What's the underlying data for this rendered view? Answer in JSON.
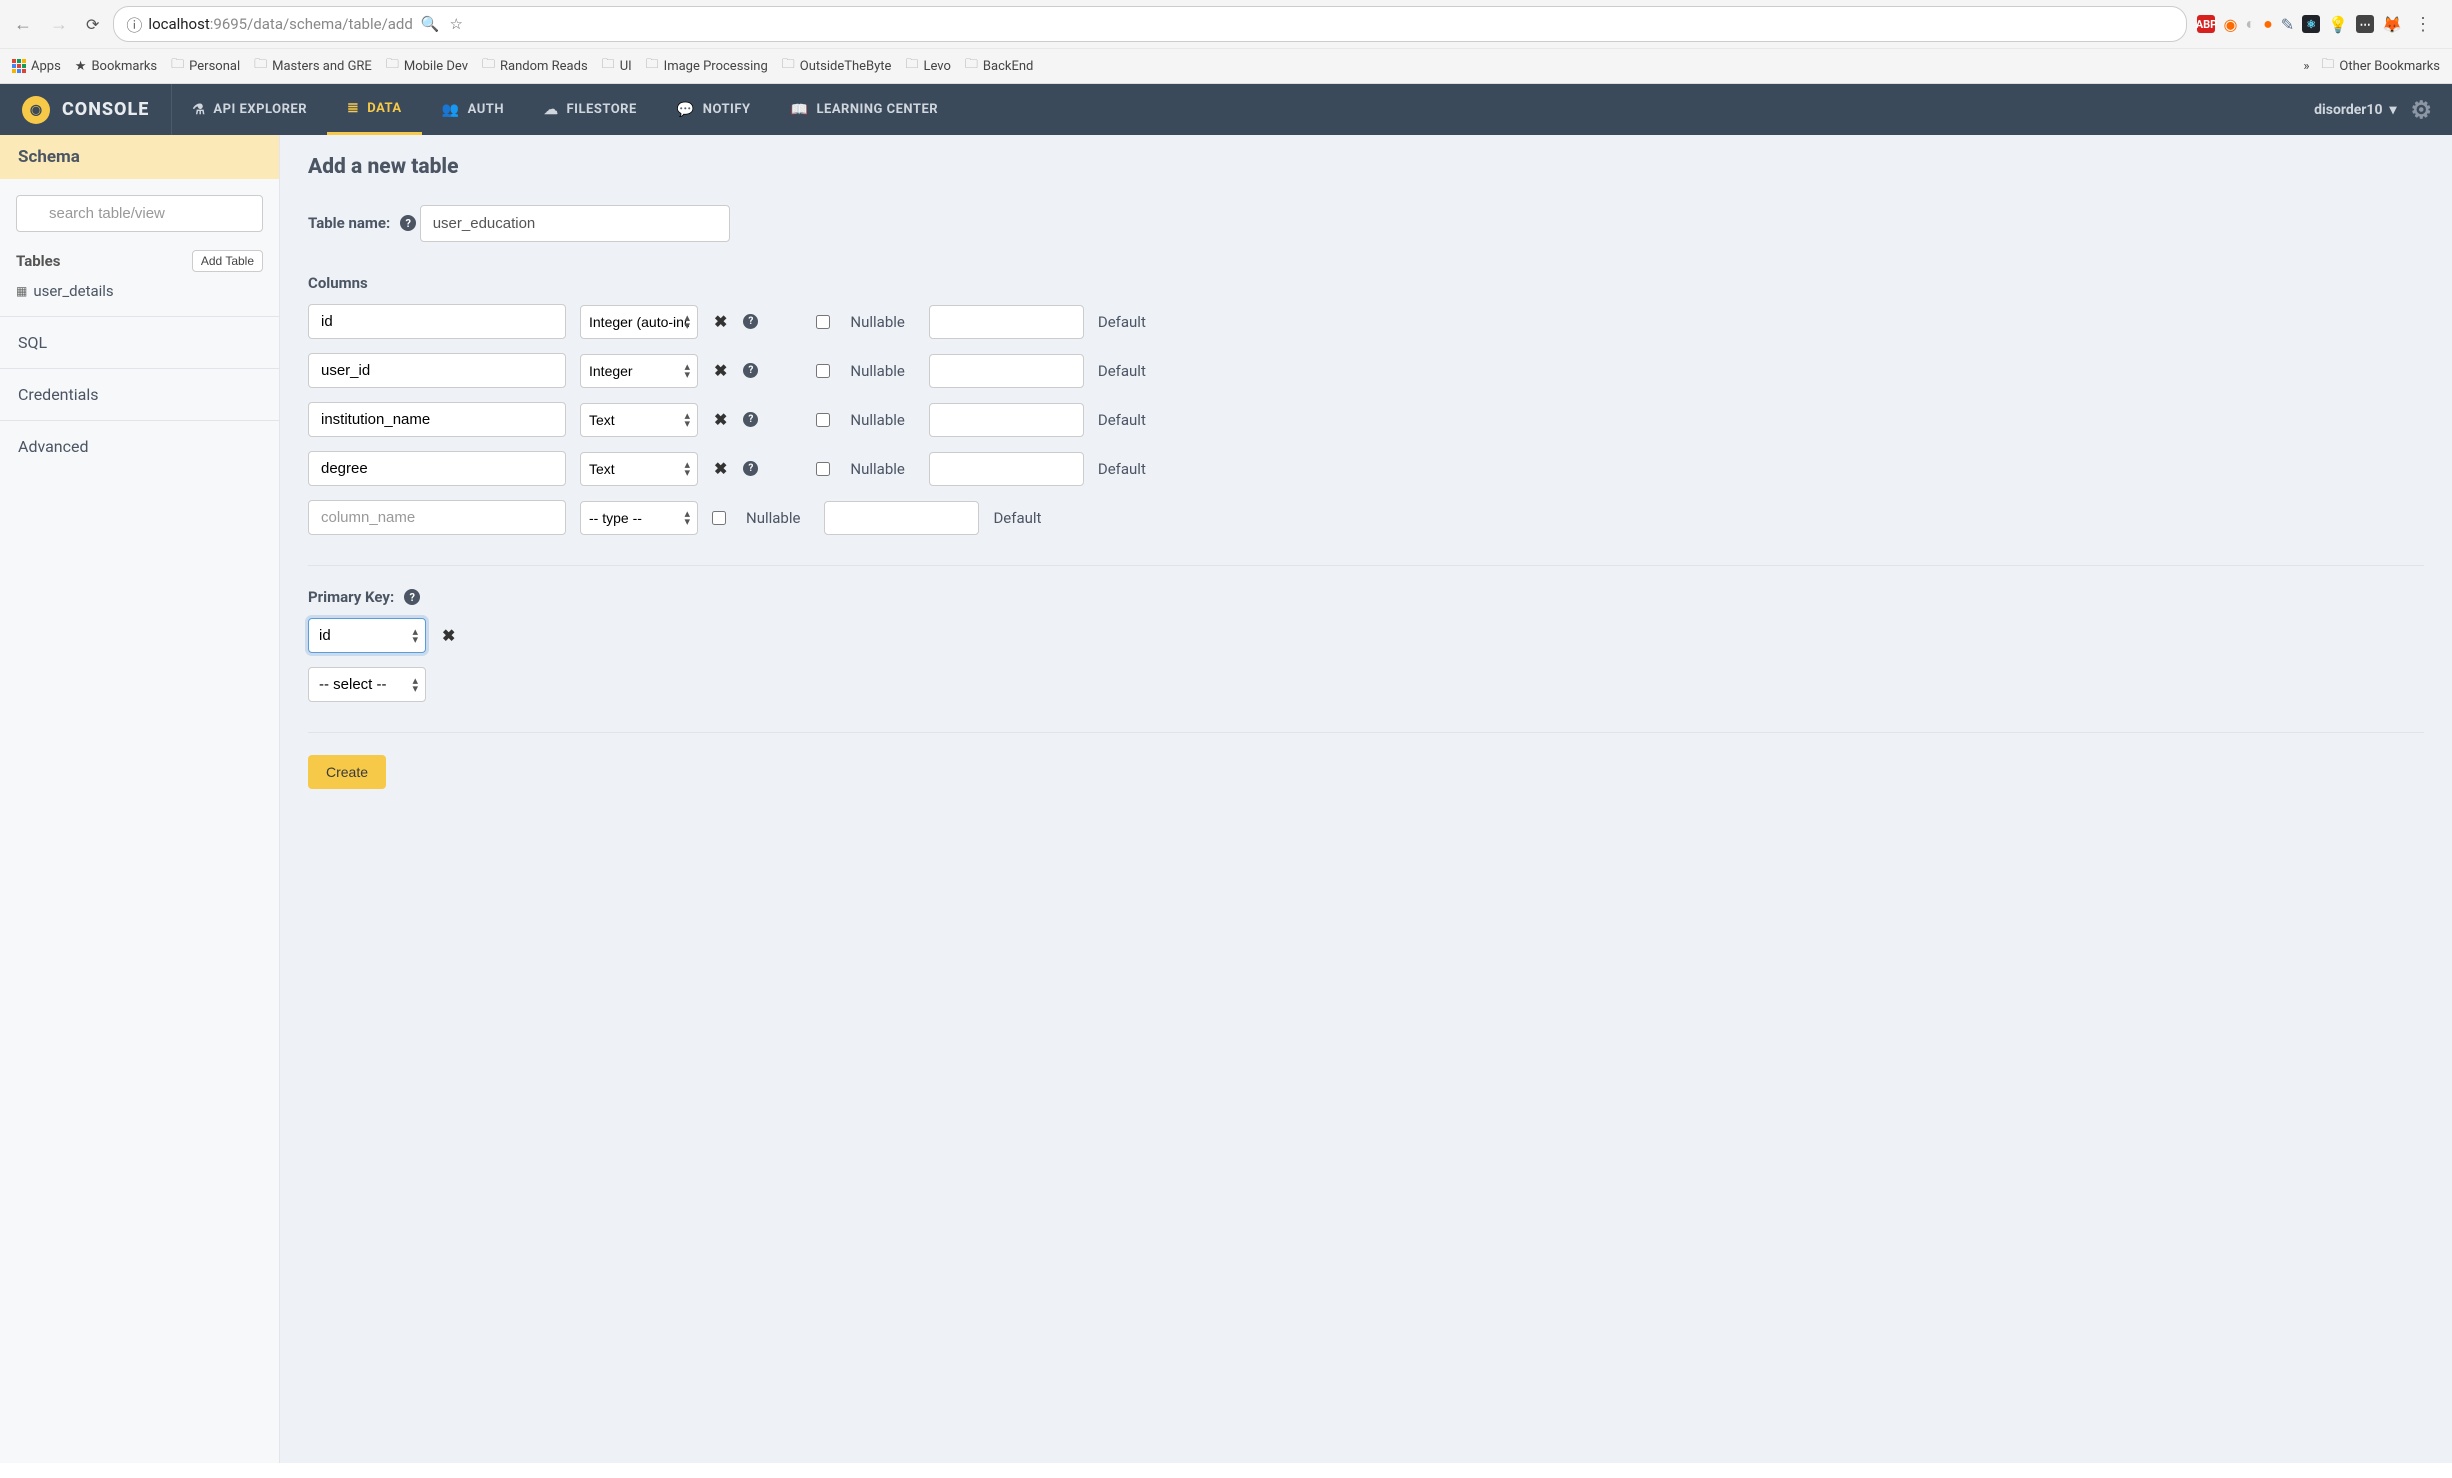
{
  "browser": {
    "url_host": "localhost",
    "url_port": ":9695",
    "url_path": "/data/schema/table/add",
    "bookmarks": [
      "Apps",
      "Bookmarks",
      "Personal",
      "Masters and GRE",
      "Mobile Dev",
      "Random Reads",
      "UI",
      "Image Processing",
      "OutsideTheByte",
      "Levo",
      "BackEnd"
    ],
    "other_bookmarks": "Other Bookmarks",
    "overflow": "»"
  },
  "header": {
    "brand": "CONSOLE",
    "nav": [
      {
        "icon": "⚗",
        "label": "API EXPLORER"
      },
      {
        "icon": "≣",
        "label": "DATA"
      },
      {
        "icon": "👥",
        "label": "AUTH"
      },
      {
        "icon": "☁",
        "label": "FILESTORE"
      },
      {
        "icon": "💬",
        "label": "NOTIFY"
      },
      {
        "icon": "📖",
        "label": "LEARNING CENTER"
      }
    ],
    "active_nav_index": 1,
    "username": "disorder10"
  },
  "sidebar": {
    "title": "Schema",
    "search_placeholder": "search table/view",
    "tables_label": "Tables",
    "add_table": "Add Table",
    "tables": [
      "user_details"
    ],
    "items": [
      "SQL",
      "Credentials",
      "Advanced"
    ]
  },
  "main": {
    "title": "Add a new table",
    "table_name_label": "Table name:",
    "table_name_value": "user_education",
    "columns_label": "Columns",
    "columns": [
      {
        "name": "id",
        "type": "Integer (auto-increment)",
        "nullable": false,
        "default": ""
      },
      {
        "name": "user_id",
        "type": "Integer",
        "nullable": false,
        "default": ""
      },
      {
        "name": "institution_name",
        "type": "Text",
        "nullable": false,
        "default": ""
      },
      {
        "name": "degree",
        "type": "Text",
        "nullable": false,
        "default": ""
      }
    ],
    "empty_col_placeholder": "column_name",
    "empty_type_placeholder": "-- type --",
    "nullable_label": "Nullable",
    "default_label": "Default",
    "primary_key_label": "Primary Key:",
    "pk_selected": "id",
    "pk_placeholder": "-- select --",
    "create_button": "Create"
  }
}
